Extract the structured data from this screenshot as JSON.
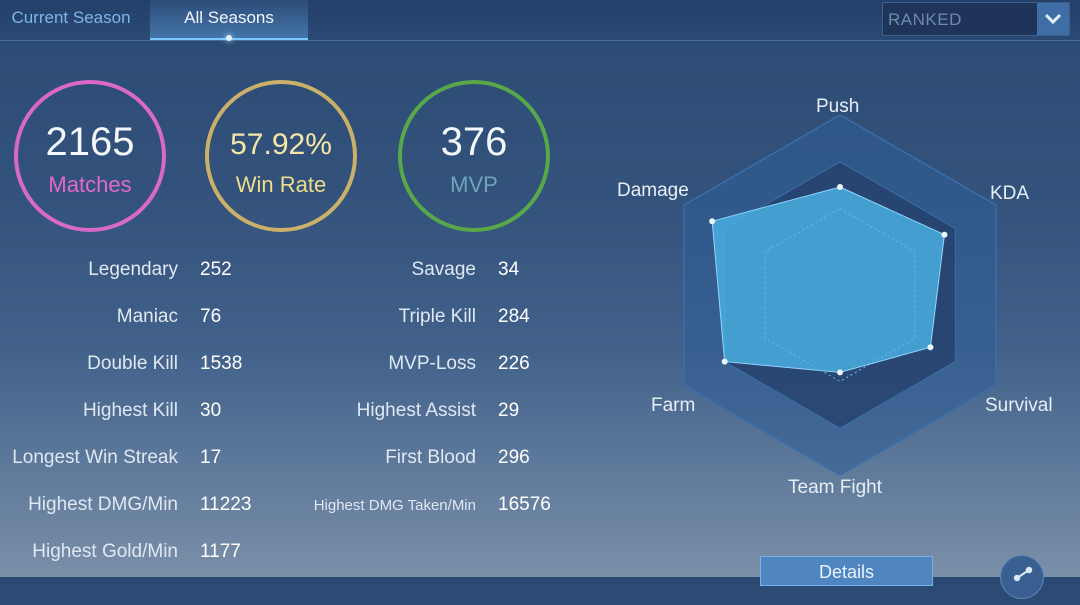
{
  "tabs": [
    {
      "label": "Current Season",
      "active": false
    },
    {
      "label": "All Seasons",
      "active": true
    }
  ],
  "mode_select": {
    "value": "RANKED",
    "icon": "chevron-down-icon"
  },
  "summary": {
    "matches": {
      "value": "2165",
      "label": "Matches",
      "color": "#d968c9"
    },
    "win_rate": {
      "value": "57.92%",
      "label": "Win Rate",
      "color": "#cbb06a"
    },
    "mvp": {
      "value": "376",
      "label": "MVP",
      "color": "#58a84a"
    }
  },
  "stats_left": [
    {
      "label": "Legendary",
      "value": "252"
    },
    {
      "label": "Maniac",
      "value": "76"
    },
    {
      "label": "Double Kill",
      "value": "1538"
    },
    {
      "label": "Highest Kill",
      "value": "30"
    },
    {
      "label": "Longest Win Streak",
      "value": "17"
    },
    {
      "label": "Highest DMG/Min",
      "value": "11223"
    },
    {
      "label": "Highest Gold/Min",
      "value": "1177"
    }
  ],
  "stats_right": [
    {
      "label": "Savage",
      "value": "34"
    },
    {
      "label": "Triple Kill",
      "value": "284"
    },
    {
      "label": "MVP-Loss",
      "value": "226"
    },
    {
      "label": "Highest Assist",
      "value": "29"
    },
    {
      "label": "First Blood",
      "value": "296"
    },
    {
      "label": "Highest DMG Taken/Min",
      "value": "16576"
    }
  ],
  "radar": {
    "axes": [
      "Push",
      "KDA",
      "Survival",
      "Team Fight",
      "Farm",
      "Damage"
    ],
    "levels": [
      0.6,
      0.67,
      0.58,
      0.43,
      0.74,
      0.82
    ],
    "fill_color": "#4aaee0"
  },
  "details_button": {
    "label": "Details"
  },
  "share_button": {
    "icon": "share-icon"
  }
}
